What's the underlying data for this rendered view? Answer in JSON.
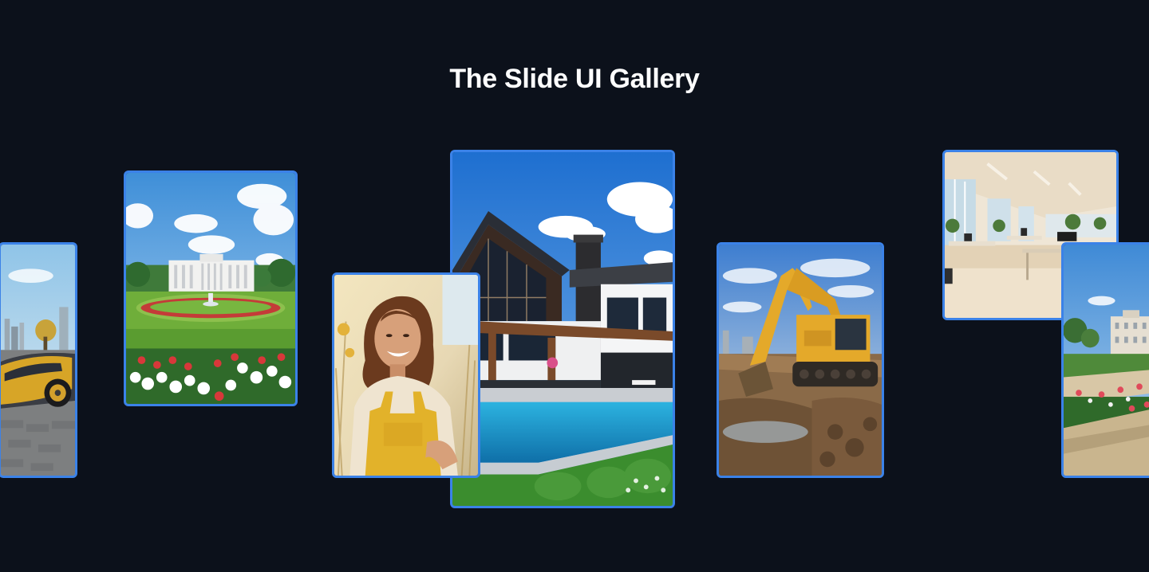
{
  "page": {
    "title": "The Slide UI Gallery"
  },
  "colors": {
    "background": "#0c111b",
    "card_border": "#3b82e8",
    "title_text": "#ffffff"
  },
  "gallery": {
    "cards": [
      {
        "subject": "gold sports car in city"
      },
      {
        "subject": "white house with flower garden"
      },
      {
        "subject": "smiling woman in yellow overalls"
      },
      {
        "subject": "modern house with swimming pool"
      },
      {
        "subject": "excavator on construction site"
      },
      {
        "subject": "bright open office interior"
      },
      {
        "subject": "mansion with formal garden"
      }
    ]
  }
}
